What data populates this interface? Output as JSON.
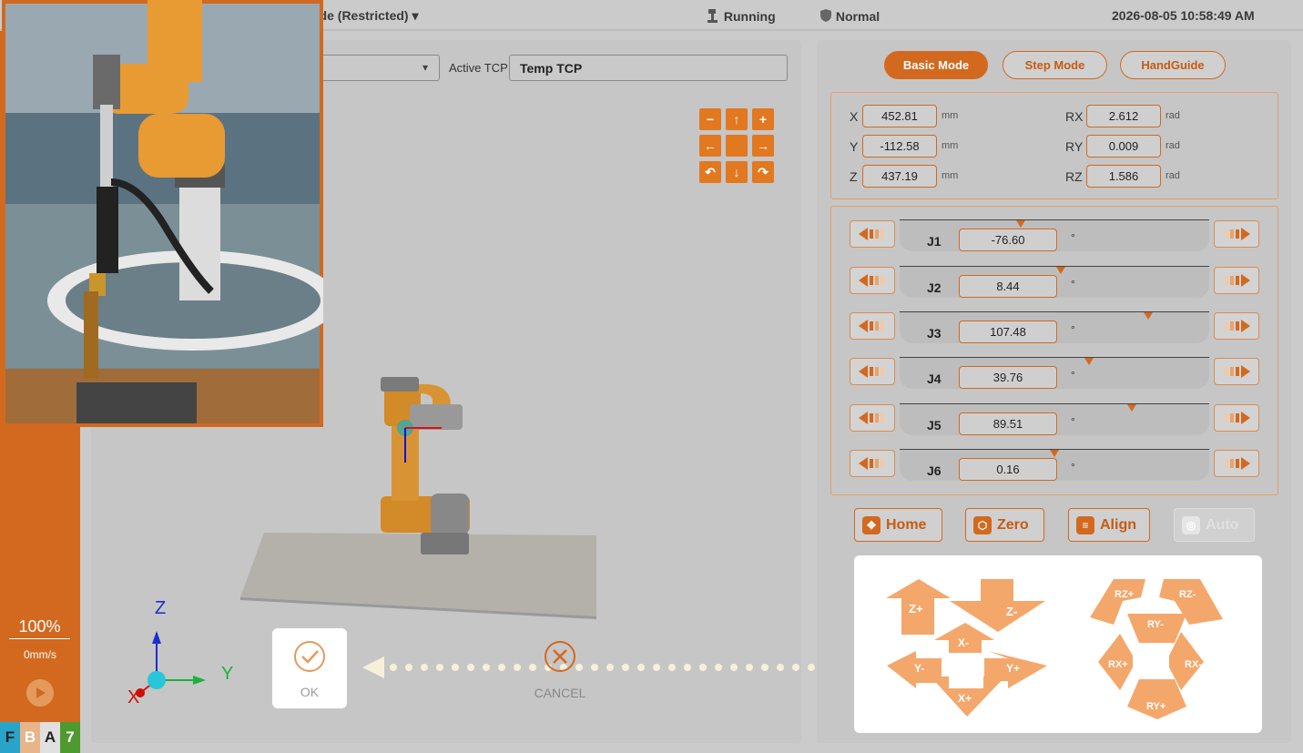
{
  "topbar": {
    "mode": "ode (Restricted)",
    "status": "Running",
    "safety": "Normal",
    "datetime": "2026-08-05 10:58:49 AM"
  },
  "tcp": {
    "label": "Active TCP",
    "value": "Temp TCP"
  },
  "modes": {
    "basic": "Basic Mode",
    "step": "Step Mode",
    "handguide": "HandGuide"
  },
  "cartesian": {
    "x": {
      "label": "X",
      "value": "452.81",
      "unit": "mm"
    },
    "y": {
      "label": "Y",
      "value": "-112.58",
      "unit": "mm"
    },
    "z": {
      "label": "Z",
      "value": "437.19",
      "unit": "mm"
    },
    "rx": {
      "label": "RX",
      "value": "2.612",
      "unit": "rad"
    },
    "ry": {
      "label": "RY",
      "value": "0.009",
      "unit": "rad"
    },
    "rz": {
      "label": "RZ",
      "value": "1.586",
      "unit": "rad"
    }
  },
  "joints": [
    {
      "label": "J1",
      "value": "-76.60",
      "unit": "°",
      "level": 0.39
    },
    {
      "label": "J2",
      "value": "8.44",
      "unit": "°",
      "level": 0.52
    },
    {
      "label": "J3",
      "value": "107.48",
      "unit": "°",
      "level": 0.8
    },
    {
      "label": "J4",
      "value": "39.76",
      "unit": "°",
      "level": 0.61
    },
    {
      "label": "J5",
      "value": "89.51",
      "unit": "°",
      "level": 0.75
    },
    {
      "label": "J6",
      "value": "0.16",
      "unit": "°",
      "level": 0.5
    }
  ],
  "actions": {
    "home": "Home",
    "zero": "Zero",
    "align": "Align",
    "auto": "Auto"
  },
  "jog": {
    "zp": "Z+",
    "zm": "Z-",
    "xm": "X-",
    "xp": "X+",
    "yp": "Y+",
    "ym": "Y-",
    "rzp": "RZ+",
    "rzm": "RZ-",
    "rym": "RY-",
    "ryp": "RY+",
    "rxp": "RX+",
    "rxm": "RX-"
  },
  "speed": {
    "percent": "100%",
    "velocity": "0mm/s"
  },
  "axes": {
    "z": "Z",
    "y": "Y",
    "x": "X"
  },
  "dialog": {
    "ok": "OK",
    "cancel": "CANCEL"
  },
  "tiles": [
    "F",
    "B",
    "A",
    "7"
  ],
  "colors": {
    "accent": "#d2691f",
    "jog": "#f4a76b"
  }
}
